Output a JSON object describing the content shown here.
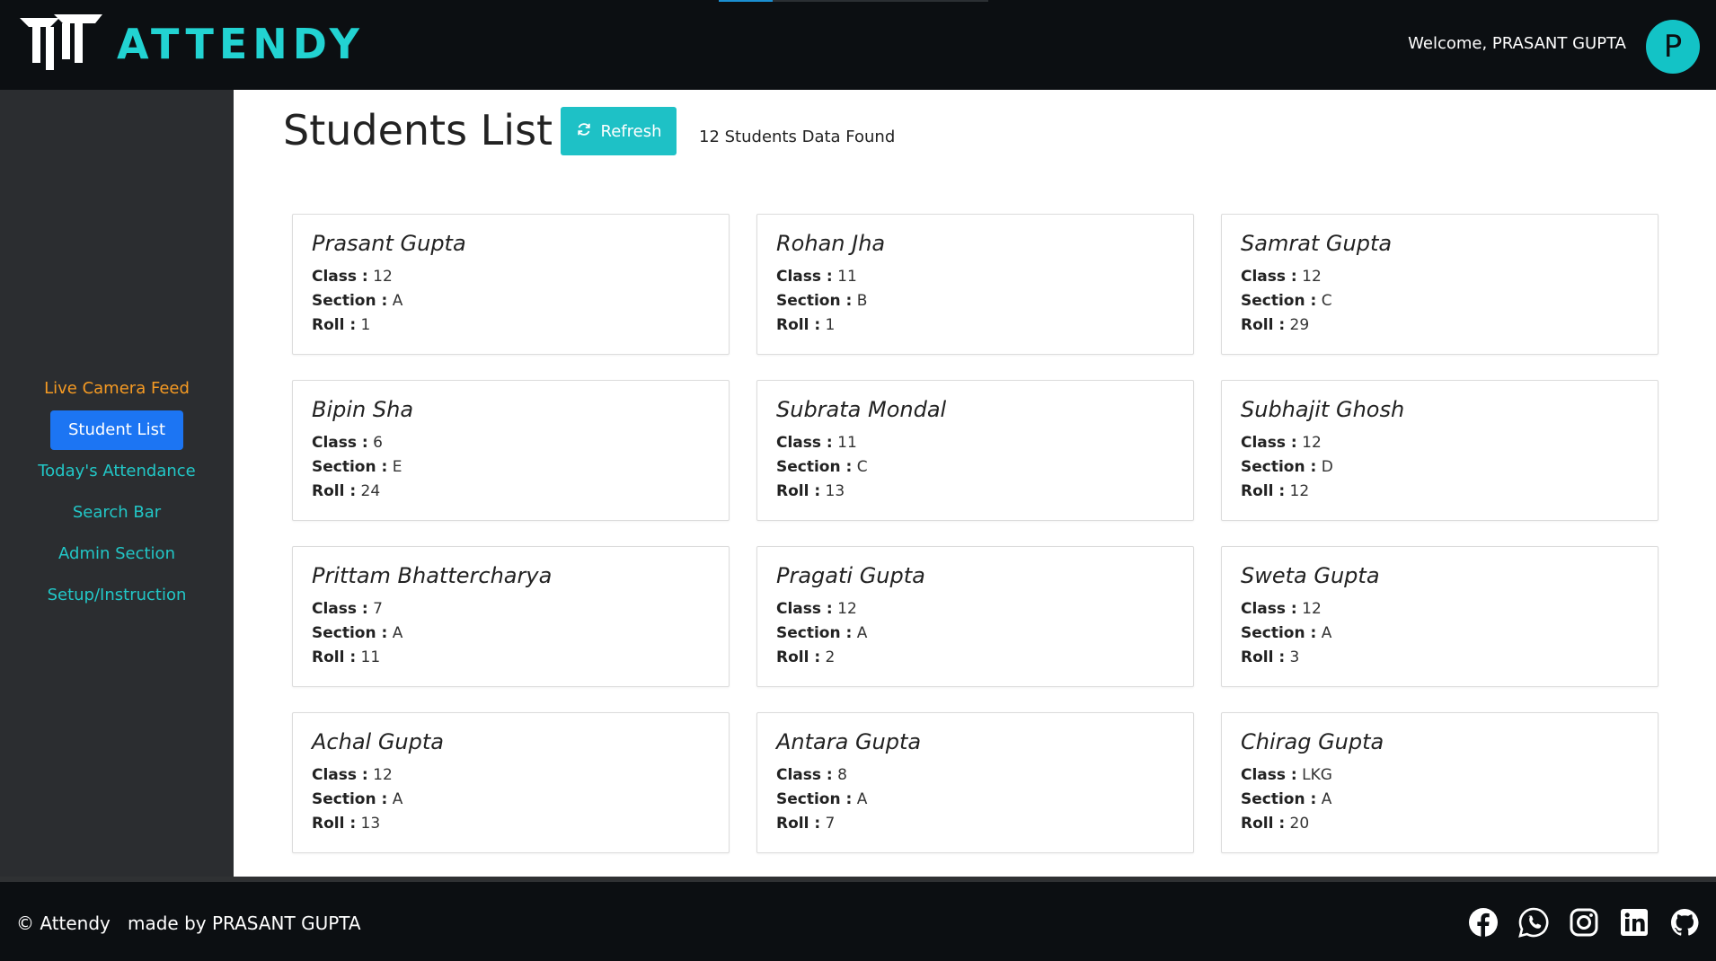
{
  "header": {
    "brand": "ATTENDY",
    "welcome": "Welcome, PRASANT GUPTA",
    "avatar_initial": "P"
  },
  "sidebar": {
    "items": [
      {
        "label": "Live Camera Feed"
      },
      {
        "label": "Student List"
      },
      {
        "label": "Today's Attendance"
      },
      {
        "label": "Search Bar"
      },
      {
        "label": "Admin Section"
      },
      {
        "label": "Setup/Instruction"
      }
    ]
  },
  "main": {
    "title": "Students List",
    "refresh_label": "Refresh",
    "found_text": "12 Students Data Found",
    "labels": {
      "class": "Class :",
      "section": "Section :",
      "roll": "Roll :"
    },
    "students": [
      {
        "name": "Prasant Gupta",
        "class": "12",
        "section": "A",
        "roll": "1"
      },
      {
        "name": "Rohan Jha",
        "class": "11",
        "section": "B",
        "roll": "1"
      },
      {
        "name": "Samrat Gupta",
        "class": "12",
        "section": "C",
        "roll": "29"
      },
      {
        "name": "Bipin Sha",
        "class": "6",
        "section": "E",
        "roll": "24"
      },
      {
        "name": "Subrata Mondal",
        "class": "11",
        "section": "C",
        "roll": "13"
      },
      {
        "name": "Subhajit Ghosh",
        "class": "12",
        "section": "D",
        "roll": "12"
      },
      {
        "name": "Prittam Bhattercharya",
        "class": "7",
        "section": "A",
        "roll": "11"
      },
      {
        "name": "Pragati Gupta",
        "class": "12",
        "section": "A",
        "roll": "2"
      },
      {
        "name": "Sweta Gupta",
        "class": "12",
        "section": "A",
        "roll": "3"
      },
      {
        "name": "Achal Gupta",
        "class": "12",
        "section": "A",
        "roll": "13"
      },
      {
        "name": "Antara Gupta",
        "class": "8",
        "section": "A",
        "roll": "7"
      },
      {
        "name": "Chirag Gupta",
        "class": "LKG",
        "section": "A",
        "roll": "20"
      }
    ]
  },
  "footer": {
    "copyright": "© Attendy",
    "made_by": "made by PRASANT GUPTA",
    "social_icons": [
      "facebook-icon",
      "whatsapp-icon",
      "instagram-icon",
      "linkedin-icon",
      "github-icon"
    ]
  },
  "colors": {
    "accent": "#1ec1c6",
    "active_nav": "#1c75f3",
    "orange_nav": "#f59a23",
    "header_bg": "#0c0f12",
    "sidebar_bg": "#2b2d30"
  }
}
